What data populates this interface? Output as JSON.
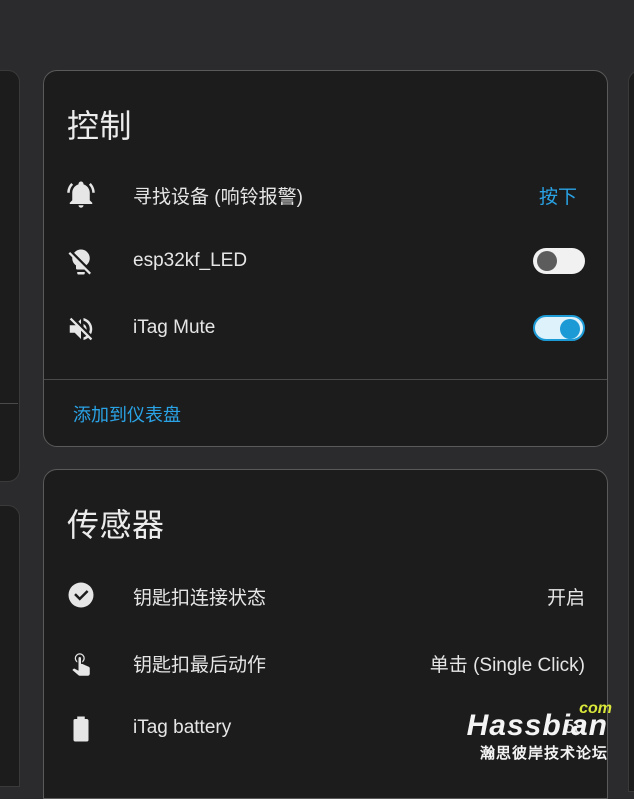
{
  "controls_card": {
    "title": "控制",
    "rows": [
      {
        "icon": "bell-ring-icon",
        "label": "寻找设备 (响铃报警)",
        "action_label": "按下"
      },
      {
        "icon": "lightbulb-off-icon",
        "label": "esp32kf_LED",
        "state": "off"
      },
      {
        "icon": "volume-off-icon",
        "label": "iTag Mute",
        "state": "on"
      }
    ],
    "footer_link": "添加到仪表盘"
  },
  "sensors_card": {
    "title": "传感器",
    "rows": [
      {
        "icon": "check-circle-icon",
        "label": "钥匙扣连接状态",
        "value": "开启"
      },
      {
        "icon": "gesture-tap-icon",
        "label": "钥匙扣最后动作",
        "value": "单击 (Single Click)"
      },
      {
        "icon": "battery-icon",
        "label": "iTag battery",
        "value": "58"
      }
    ]
  },
  "watermark": {
    "suffix": "com",
    "brand": "Hassbian",
    "subtitle": "瀚思彼岸技术论坛"
  },
  "colors": {
    "accent": "#2aa3e6",
    "card_bg": "#1c1c1c",
    "page_bg": "#2b2b2d"
  }
}
